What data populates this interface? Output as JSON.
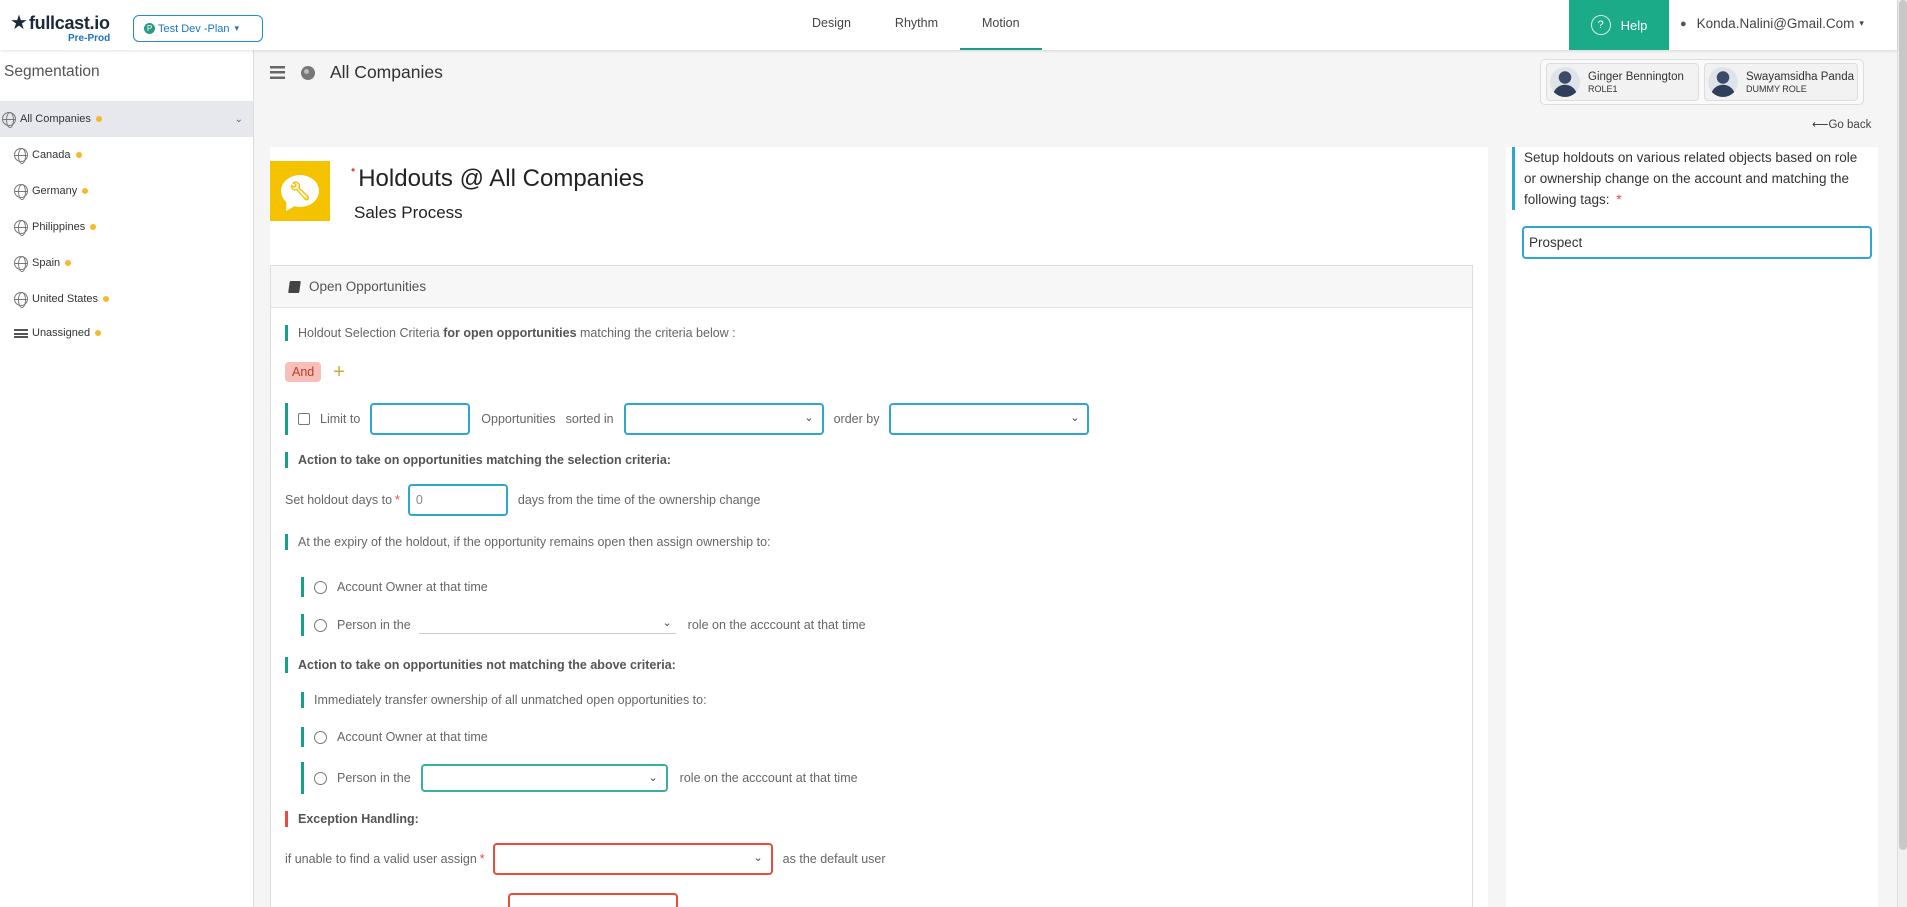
{
  "brand": {
    "name": "fullcast.io",
    "env": "Pre-Prod"
  },
  "plan_selector": {
    "badge": "P",
    "label": "Test Dev -Plan"
  },
  "topnav": {
    "tabs": [
      "Design",
      "Rhythm",
      "Motion"
    ],
    "active": "Motion"
  },
  "help": {
    "label": "Help"
  },
  "user": {
    "email": "Konda.Nalini@Gmail.Com"
  },
  "sidebar": {
    "title": "Segmentation",
    "items": [
      {
        "label": "All Companies",
        "active": true
      },
      {
        "label": "Canada"
      },
      {
        "label": "Germany"
      },
      {
        "label": "Philippines"
      },
      {
        "label": "Spain"
      },
      {
        "label": "United States"
      },
      {
        "label": "Unassigned"
      }
    ]
  },
  "header": {
    "title": "All Companies",
    "owners": [
      {
        "name": "Ginger Bennington",
        "role": "ROLE1"
      },
      {
        "name": "Swayamsidha Panda",
        "role": "DUMMY ROLE"
      }
    ],
    "go_back": "⟵Go back"
  },
  "holdout": {
    "title": "Holdouts @ All Companies",
    "subtitle": "Sales Process",
    "card_title": "Open Opportunities",
    "criteria": {
      "prefix": "Holdout Selection Criteria ",
      "bold": "for open opportunities",
      "suffix": " matching the criteria below :"
    },
    "and_label": "And",
    "limit": {
      "label": "Limit to",
      "unit": "Opportunities",
      "sorted": "sorted in",
      "order": "order by"
    },
    "action_matching": "Action to take on opportunities matching the selection criteria:",
    "holdout_days": {
      "label": "Set holdout days to",
      "value": "0",
      "suffix": "days from the time of the ownership change"
    },
    "expiry_text": "At the expiry of the holdout, if the opportunity remains open then assign ownership to:",
    "option_account_owner": "Account Owner at that time",
    "option_person_prefix": "Person in the",
    "option_person_suffix": "role on the acccount at that time",
    "action_not_matching": "Action to take on opportunities not matching the above criteria:",
    "immediate_text": "Immediately transfer ownership of all unmatched open opportunities to:",
    "exception_title": "Exception Handling:",
    "exception_assign": {
      "label": "if unable to find a valid user assign",
      "suffix": "as the default user"
    }
  },
  "right_panel": {
    "description": "Setup holdouts on various related objects based on role or ownership change on the account and matching the following tags:",
    "tag_value": "Prospect"
  },
  "colors": {
    "accent": "#16a085",
    "help_bg": "#1bab88",
    "input_border": "#2fa6cd",
    "required": "#e74c3c",
    "holdout_icon": "#f5c200"
  }
}
